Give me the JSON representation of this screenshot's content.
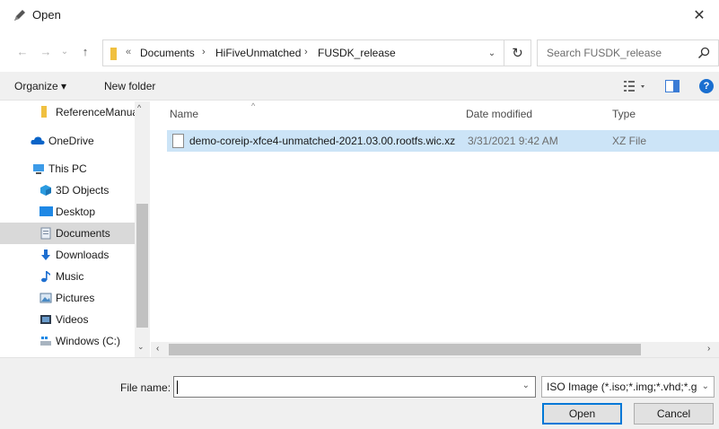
{
  "titlebar": {
    "title": "Open",
    "close_glyph": "✕"
  },
  "address": {
    "overflow_glyph": "«",
    "crumbs": [
      "Documents",
      "HiFiveUnmatched",
      "FUSDK_release"
    ],
    "separator": "›",
    "dropdown_glyph": "⌄",
    "refresh_glyph": "↻"
  },
  "nav_buttons": {
    "back": "←",
    "forward": "→",
    "recent": "⌄",
    "up": "↑"
  },
  "search": {
    "placeholder": "Search FUSDK_release",
    "icon": "search-icon"
  },
  "toolbar": {
    "organize": "Organize ▾",
    "new_folder": "New folder",
    "help_glyph": "?"
  },
  "nav_pane": {
    "items": [
      {
        "label": "ReferenceManua",
        "icon": "folder-icon",
        "indent": 2
      },
      {
        "label": "OneDrive",
        "icon": "cloud-icon",
        "indent": 1
      },
      {
        "label": "This PC",
        "icon": "computer-icon",
        "indent": 1
      },
      {
        "label": "3D Objects",
        "icon": "cube-icon",
        "indent": 2
      },
      {
        "label": "Desktop",
        "icon": "desktop-icon",
        "indent": 2
      },
      {
        "label": "Documents",
        "icon": "documents-icon",
        "indent": 2,
        "selected": true
      },
      {
        "label": "Downloads",
        "icon": "download-icon",
        "indent": 2
      },
      {
        "label": "Music",
        "icon": "music-icon",
        "indent": 2
      },
      {
        "label": "Pictures",
        "icon": "pictures-icon",
        "indent": 2
      },
      {
        "label": "Videos",
        "icon": "videos-icon",
        "indent": 2
      },
      {
        "label": "Windows (C:)",
        "icon": "drive-icon",
        "indent": 2
      }
    ],
    "scroll_up": "^",
    "scroll_down": "⌄"
  },
  "file_list": {
    "columns": [
      "Name",
      "Date modified",
      "Type"
    ],
    "sort_glyph": "^",
    "rows": [
      {
        "name": "demo-coreip-xfce4-unmatched-2021.03.00.rootfs.wic.xz",
        "date": "3/31/2021 9:42 AM",
        "type": "XZ File",
        "selected": true
      }
    ],
    "hscroll_left": "‹",
    "hscroll_right": "›"
  },
  "bottom": {
    "file_name_label": "File name:",
    "file_name_value": "",
    "file_name_dd": "⌄",
    "file_type": "ISO Image (*.iso;*.img;*.vhd;*.g",
    "file_type_dd": "⌄",
    "open_label": "Open",
    "cancel_label": "Cancel"
  },
  "colors": {
    "accent": "#0078d7",
    "selection": "#cce4f7",
    "nav_selected": "#d9d9d9",
    "chrome": "#f0f0f0"
  }
}
